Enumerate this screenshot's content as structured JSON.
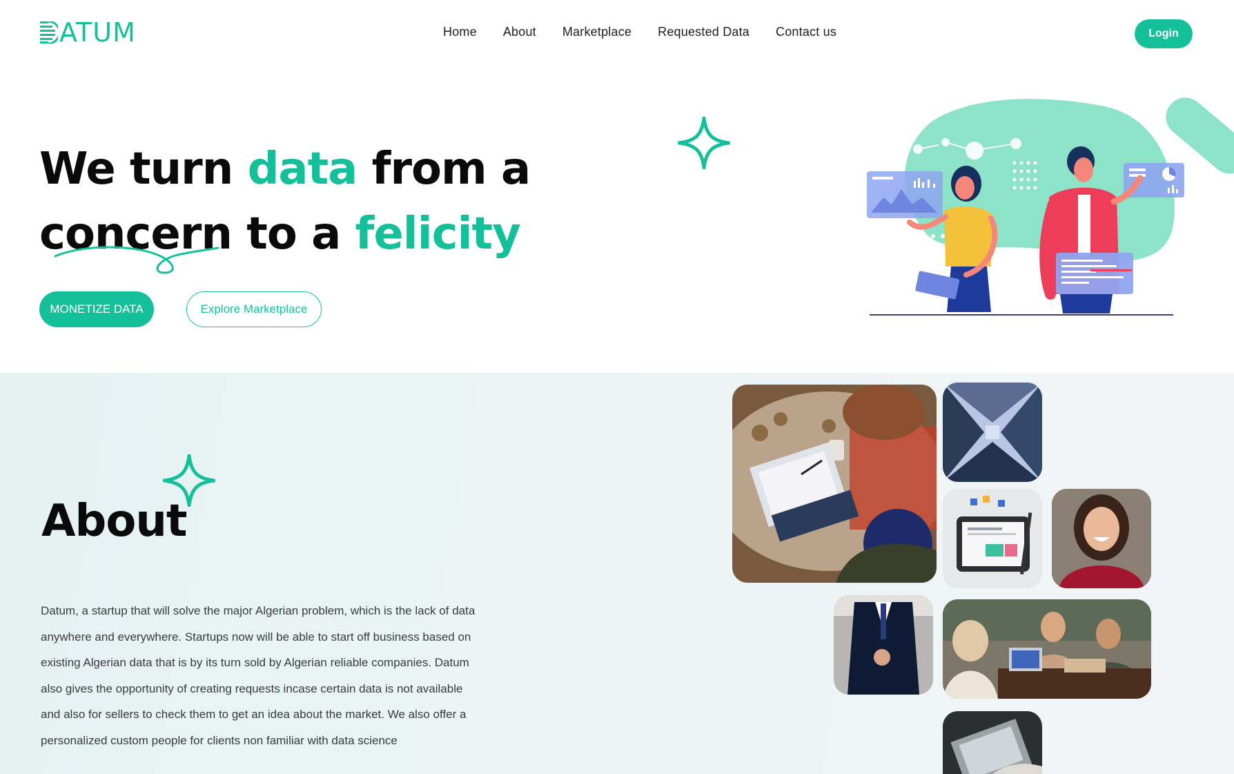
{
  "header": {
    "logo_text": "ATUM",
    "nav": [
      "Home",
      "About",
      "Marketplace",
      "Requested Data",
      "Contact us"
    ],
    "login_label": "Login"
  },
  "hero": {
    "title_part1": "We turn ",
    "title_accent1": "data",
    "title_part2": " from a",
    "title_part3": "concern",
    "title_part4": " to a ",
    "title_accent2": "felicity",
    "primary_button": "MONETIZE DATA",
    "secondary_button": "Explore Marketplace"
  },
  "about": {
    "title": "About",
    "lines": [
      "Datum, a startup that will solve the major Algerian problem, which is the lack of data",
      "anywhere and everywhere. Startups now will be able to start off business based on",
      "existing Algerian data that is by its turn sold by Algerian reliable companies. Datum",
      "also gives the opportunity of creating requests incase certain data is not available",
      "and also for sellers to check them to get an idea about the market. We also offer a",
      "personalized custom people for clients non familiar with data science"
    ]
  },
  "colors": {
    "accent": "#14c09a",
    "about_bg": "#e9f3f4",
    "heading": "#0a0a0a"
  },
  "icons": [
    "logo-d-icon",
    "sparkle-star-icon"
  ]
}
